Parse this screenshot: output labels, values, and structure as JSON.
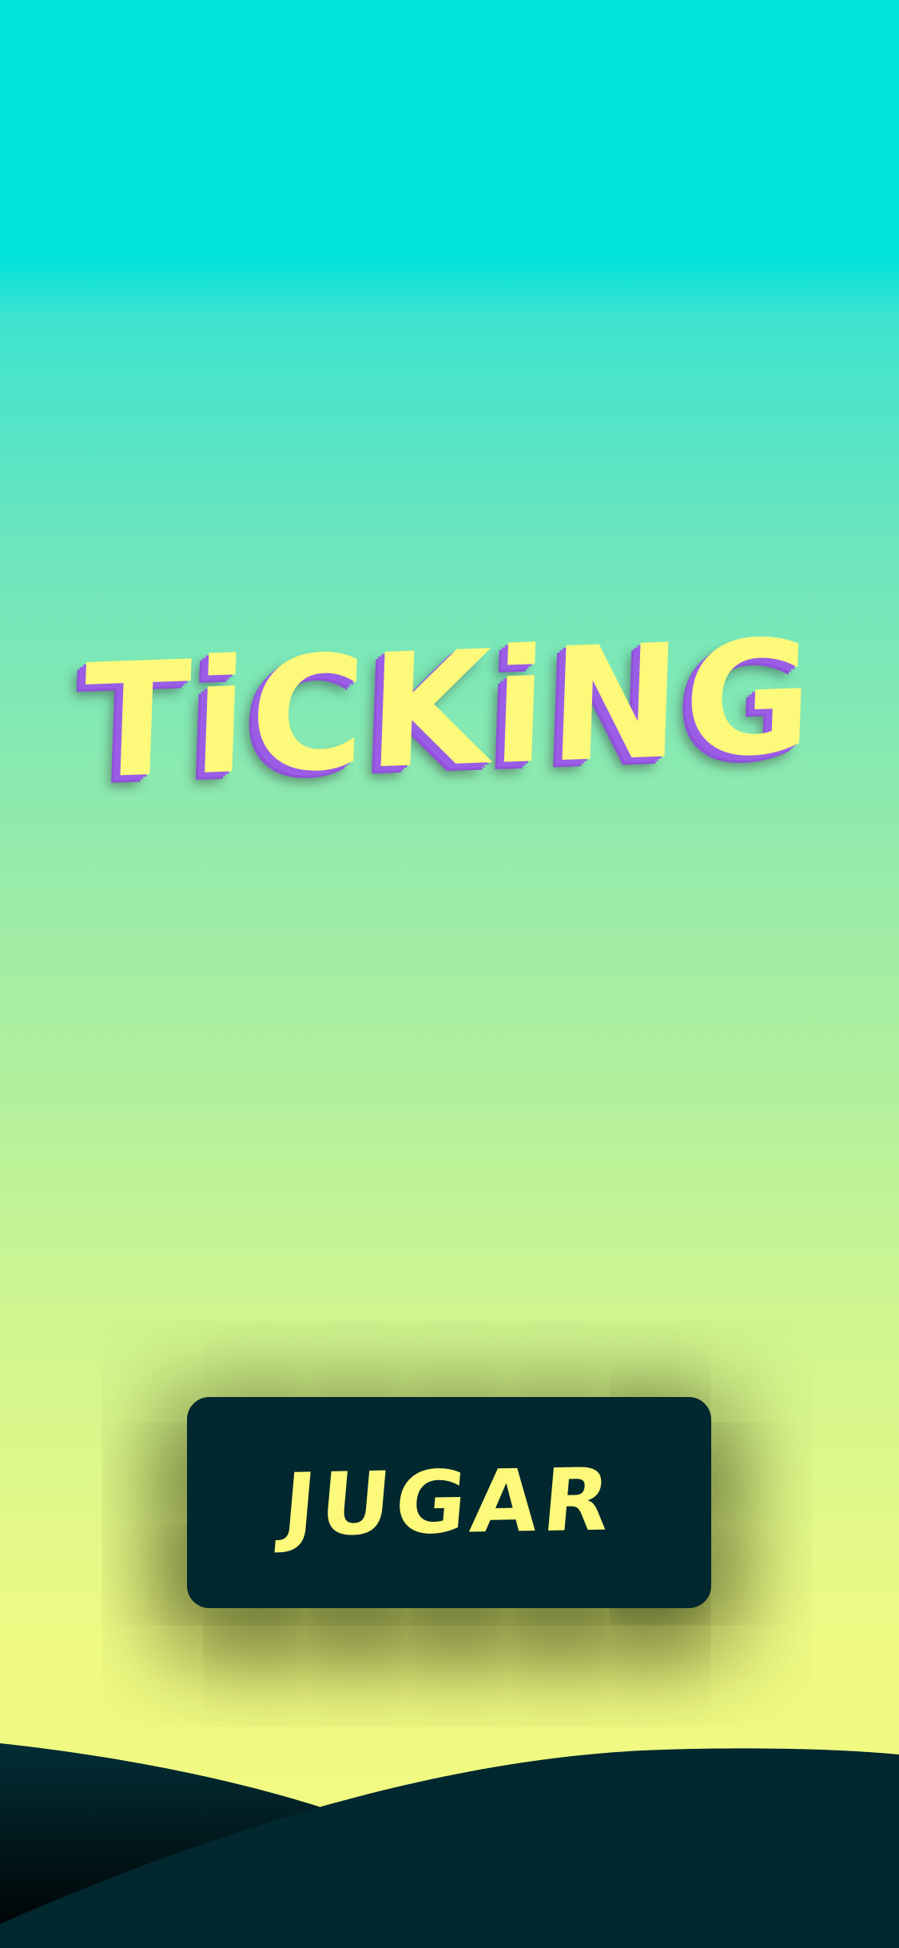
{
  "game": {
    "title": "TiCKiNG",
    "play_button_label": "JUGAR"
  },
  "colors": {
    "sky_top": "#00e3dc",
    "sky_bottom": "#f4fb80",
    "title_fill": "#fdf97a",
    "title_outline": "#9b5de5",
    "button_bg": "#01272f",
    "button_text": "#fdf97a",
    "hill_front": "#01272f",
    "hill_back": "#000000"
  }
}
